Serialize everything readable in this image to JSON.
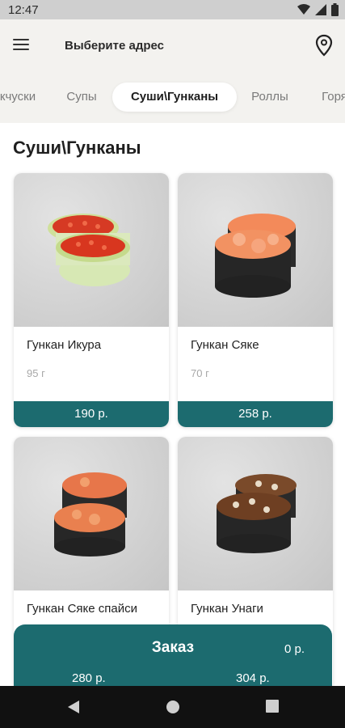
{
  "status_bar": {
    "time": "12:47"
  },
  "app_bar": {
    "address": "Выберите адрес"
  },
  "tabs": [
    {
      "label": "кчуски",
      "active": false
    },
    {
      "label": "Супы",
      "active": false
    },
    {
      "label": "Суши\\Гунканы",
      "active": true
    },
    {
      "label": "Роллы",
      "active": false
    },
    {
      "label": "Горя",
      "active": false
    }
  ],
  "section": {
    "title": "Суши\\Гунканы"
  },
  "products": [
    {
      "name": "Гункан Икура",
      "weight": "95 г",
      "price": "190 р."
    },
    {
      "name": "Гункан Сяке",
      "weight": "70 г",
      "price": "258 р."
    },
    {
      "name": "Гункан Сяке спайси",
      "weight": "",
      "price": "280 р."
    },
    {
      "name": "Гункан Унаги",
      "weight": "",
      "price": "304 р."
    }
  ],
  "order": {
    "label": "Заказ",
    "total": "0 р."
  },
  "colors": {
    "accent": "#1c6b6f",
    "background": "#f3f2ef"
  }
}
